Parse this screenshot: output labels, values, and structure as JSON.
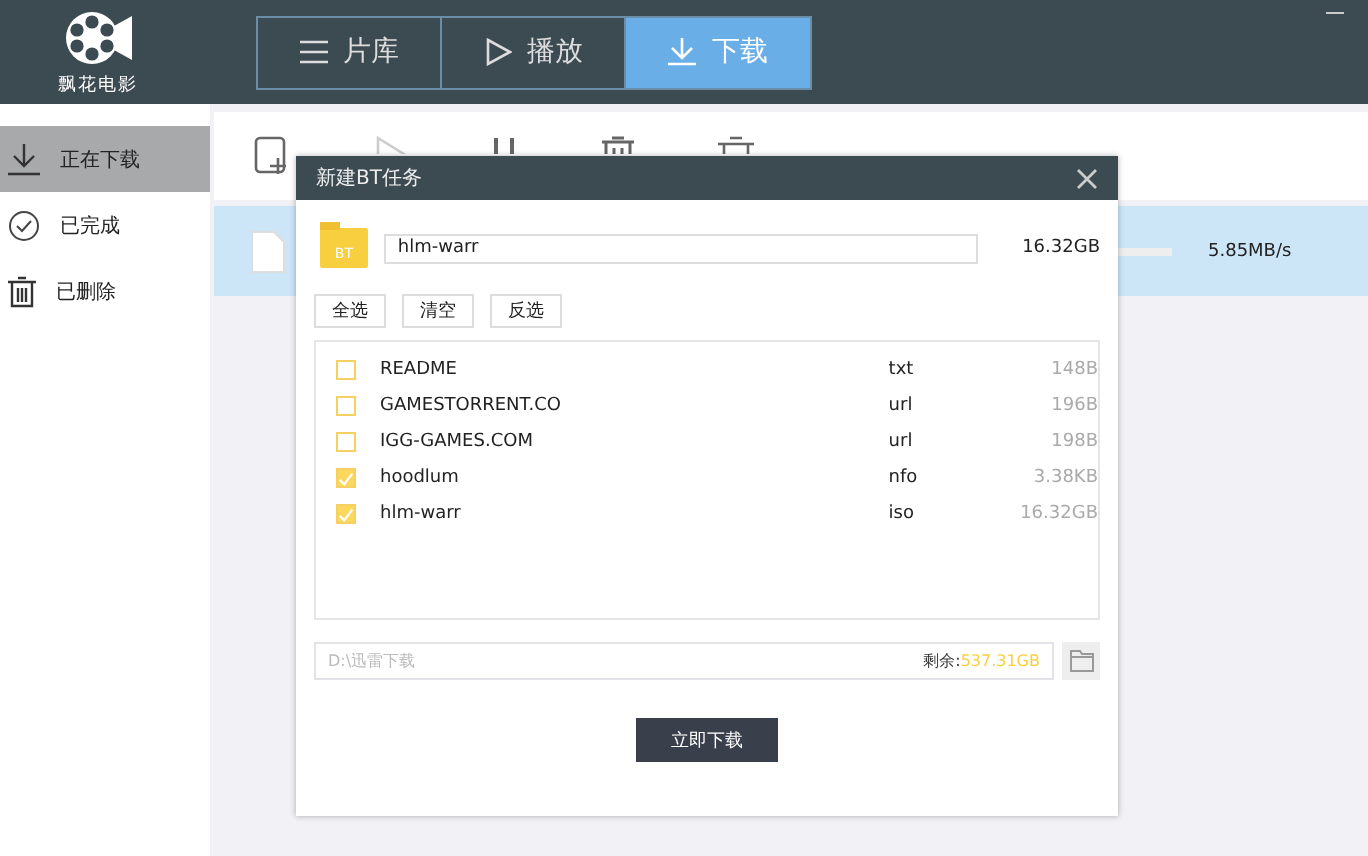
{
  "app": {
    "logo_text": "飘花电影"
  },
  "tabs": [
    {
      "label": "片库",
      "selected": false
    },
    {
      "label": "播放",
      "selected": false
    },
    {
      "label": "下载",
      "selected": true
    }
  ],
  "sidebar": {
    "items": [
      {
        "label": "正在下载",
        "selected": true
      },
      {
        "label": "已完成",
        "selected": false
      },
      {
        "label": "已删除",
        "selected": false
      }
    ]
  },
  "toolbar": [
    {
      "disabled": false
    },
    {
      "disabled": true
    },
    {
      "disabled": false
    },
    {
      "disabled": false
    },
    {
      "disabled": false
    }
  ],
  "downloads": [
    {
      "speed": "5.85MB/s",
      "selected": true
    }
  ],
  "dialog": {
    "title": "新建BT任务",
    "folder_badge": "BT",
    "name": "hlm-warr",
    "total_size": "16.32GB",
    "buttons": [
      "全选",
      "清空",
      "反选"
    ],
    "files": [
      {
        "name": "README",
        "ext": "txt",
        "size": "148B",
        "checked": false
      },
      {
        "name": "GAMESTORRENT.CO",
        "ext": "url",
        "size": "196B",
        "checked": false
      },
      {
        "name": "IGG-GAMES.COM",
        "ext": "url",
        "size": "198B",
        "checked": false
      },
      {
        "name": "hoodlum",
        "ext": "nfo",
        "size": "3.38KB",
        "checked": true
      },
      {
        "name": "hlm-warr",
        "ext": "iso",
        "size": "16.32GB",
        "checked": true
      }
    ],
    "path": "D:\\迅雷下载",
    "free_label": "剩余:",
    "free_value": "537.31GB",
    "submit": "立即下载"
  }
}
